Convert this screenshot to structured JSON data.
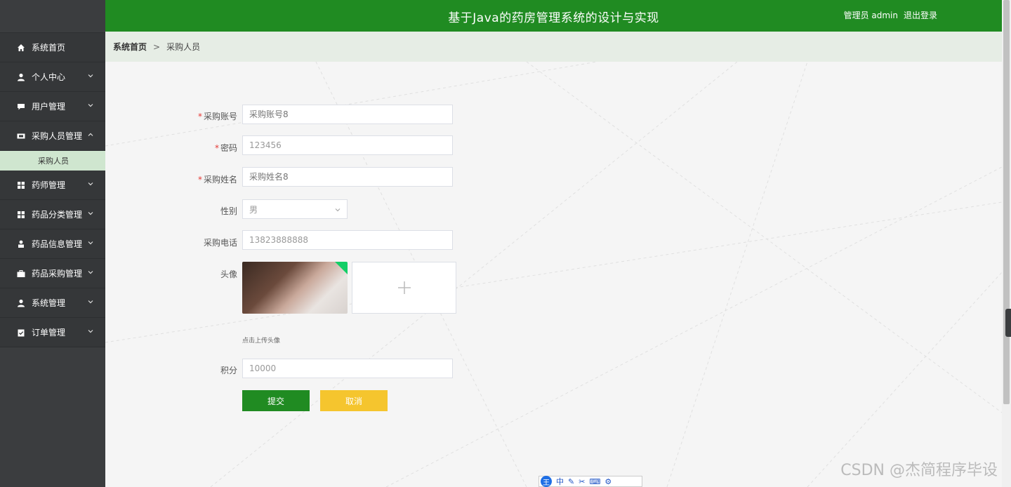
{
  "header": {
    "title": "基于Java的药房管理系统的设计与实现",
    "user": "管理员 admin",
    "logout": "退出登录"
  },
  "breadcrumb": {
    "home": "系统首页",
    "separator": ">",
    "current": "采购人员"
  },
  "sidebar": {
    "items": [
      {
        "label": "系统首页",
        "icon": "home-icon"
      },
      {
        "label": "个人中心",
        "icon": "user-icon"
      },
      {
        "label": "用户管理",
        "icon": "chat-icon"
      },
      {
        "label": "采购人员管理",
        "icon": "card-icon"
      },
      {
        "label": "药师管理",
        "icon": "grid-icon"
      },
      {
        "label": "药品分类管理",
        "icon": "grid-icon"
      },
      {
        "label": "药品信息管理",
        "icon": "person-icon"
      },
      {
        "label": "药品采购管理",
        "icon": "briefcase-icon"
      },
      {
        "label": "系统管理",
        "icon": "user-icon"
      },
      {
        "label": "订单管理",
        "icon": "clipboard-icon"
      }
    ],
    "submenu": {
      "label": "采购人员"
    }
  },
  "form": {
    "account": {
      "label": "采购账号",
      "placeholder": "采购账号8"
    },
    "password": {
      "label": "密码",
      "value": "123456"
    },
    "name": {
      "label": "采购姓名",
      "placeholder": "采购姓名8"
    },
    "gender": {
      "label": "性别",
      "value": "男"
    },
    "phone": {
      "label": "采购电话",
      "value": "13823888888"
    },
    "avatar": {
      "label": "头像",
      "hint": "点击上传头像"
    },
    "points": {
      "label": "积分",
      "value": "10000"
    },
    "submit": "提交",
    "cancel": "取消"
  },
  "watermark": "CSDN @杰简程序毕设",
  "ime": {
    "logo": "王",
    "mode": "中"
  },
  "colors": {
    "primary": "#208b22",
    "cancel": "#f5c52e",
    "sidebar": "#353739"
  }
}
